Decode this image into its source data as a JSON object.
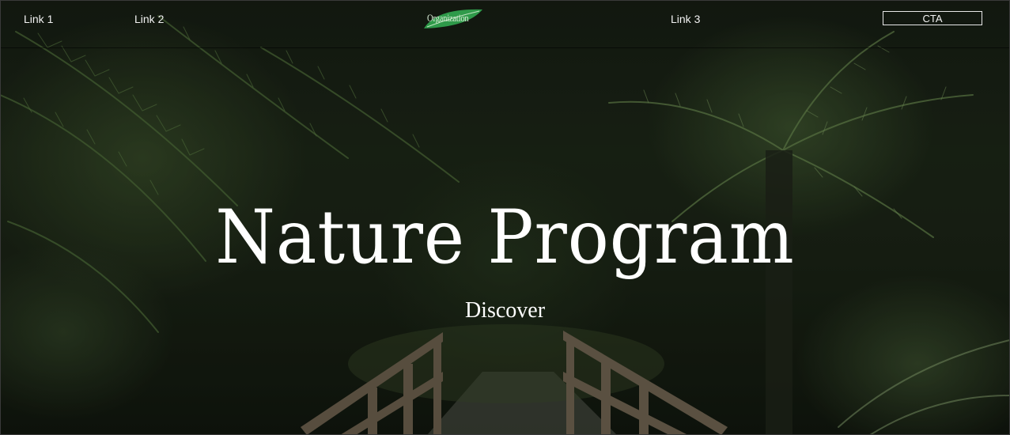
{
  "nav": {
    "links": [
      "Link 1",
      "Link 2",
      "Link 3"
    ],
    "logo_text": "Organization",
    "cta_label": "CTA"
  },
  "hero": {
    "title": "Nature Program",
    "subtitle": "Discover"
  },
  "colors": {
    "text": "#ffffff",
    "logo_leaf": "#2f9a4a",
    "background": "#1a2315"
  }
}
